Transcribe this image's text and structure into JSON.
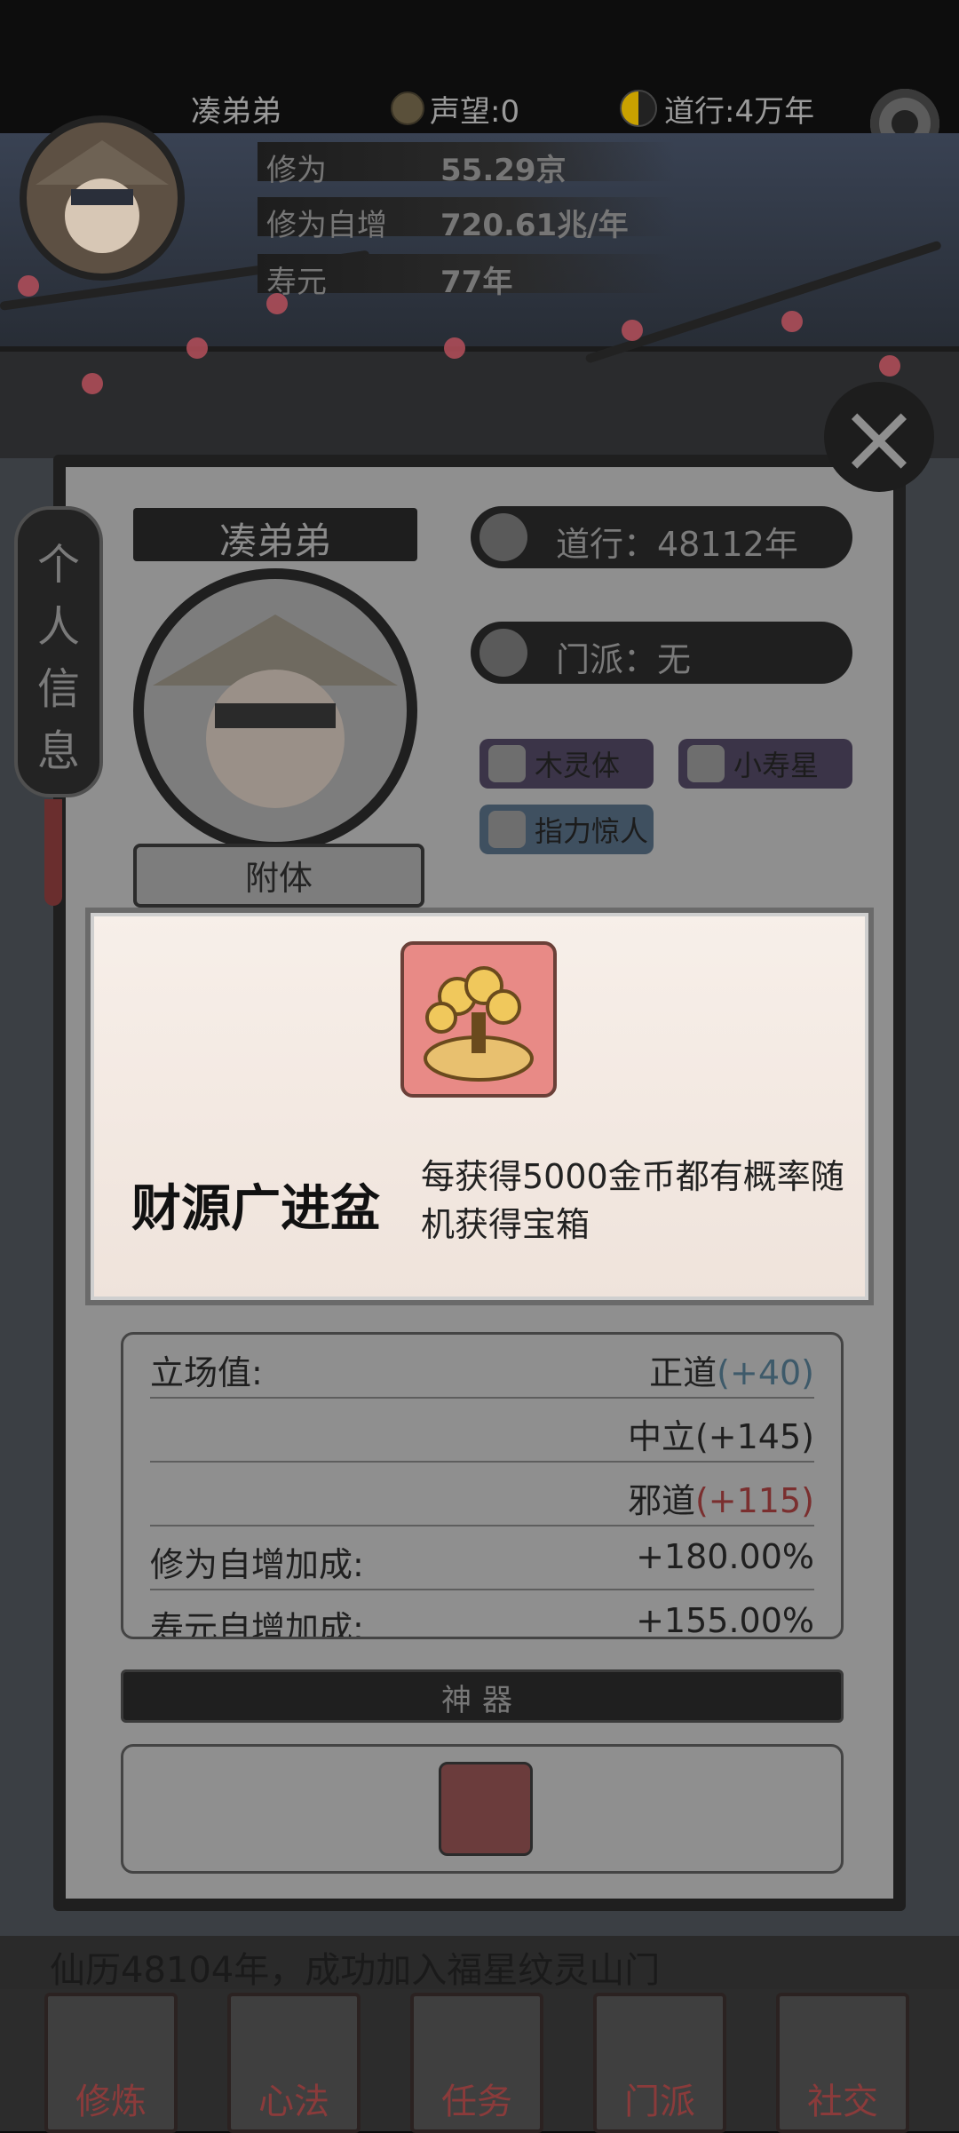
{
  "header": {
    "player_name": "凑弟弟",
    "reputation": "声望:0",
    "daoxing_short": "道行:4万年",
    "stats": [
      {
        "label": "修为",
        "value": "55.29京"
      },
      {
        "label": "修为自增",
        "value": "720.61兆/年"
      },
      {
        "label": "寿元",
        "value": "77年"
      }
    ]
  },
  "profile": {
    "tab_title_chars": [
      "个",
      "人",
      "信",
      "息"
    ],
    "name": "凑弟弟",
    "daoxing": "道行：48112年",
    "sect": "门派：无",
    "attach_button": "附体",
    "tags": [
      "木灵体",
      "小寿星",
      "指力惊人"
    ]
  },
  "popup": {
    "item_name": "财源广进盆",
    "item_desc": "每获得5000金币都有概率随机获得宝箱"
  },
  "stats_table": {
    "rows": [
      {
        "label": "立场值:",
        "right": "正道",
        "delta": "(+40)",
        "delta_type": "good"
      },
      {
        "label": "",
        "right": "中立(+145)",
        "delta": "",
        "delta_type": "neutral"
      },
      {
        "label": "",
        "right": "邪道",
        "delta": "(+115)",
        "delta_type": "bad"
      },
      {
        "label": "修为自增加成:",
        "right": "+180.00%",
        "delta": "",
        "delta_type": "neutral"
      },
      {
        "label": "寿元自增加成:",
        "right": "+155.00%",
        "delta": "",
        "delta_type": "neutral"
      }
    ]
  },
  "artifact_section": {
    "title": "神器"
  },
  "log_line": "仙历48104年，成功加入福星纹灵山门",
  "nav": [
    {
      "label": "修炼"
    },
    {
      "label": "心法"
    },
    {
      "label": "任务"
    },
    {
      "label": "门派"
    },
    {
      "label": "社交"
    }
  ],
  "colors": {
    "accent_red": "#b54f5b",
    "good": "#3e5a6a",
    "bad": "#7a2f2f"
  }
}
